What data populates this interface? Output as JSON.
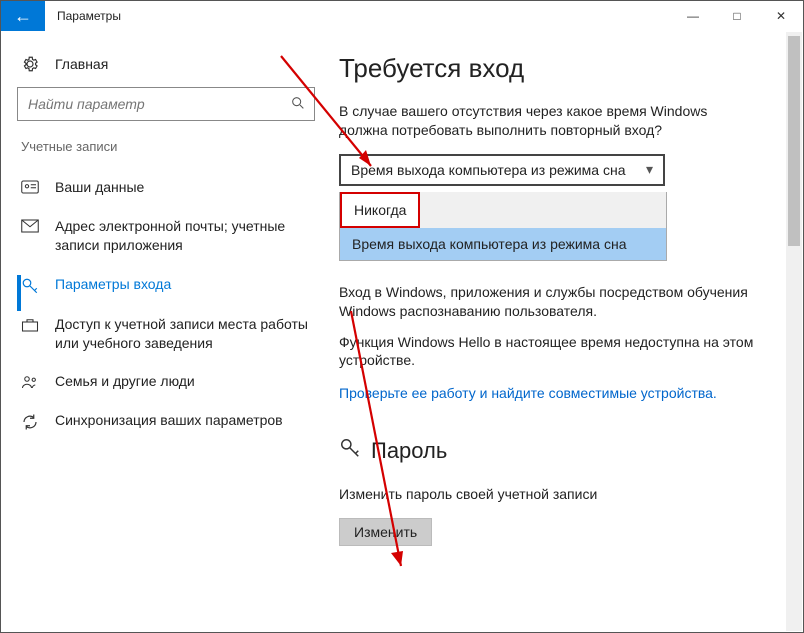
{
  "window": {
    "title": "Параметры"
  },
  "sidebar": {
    "home": "Главная",
    "search_placeholder": "Найти параметр",
    "section": "Учетные записи",
    "items": [
      {
        "label": "Ваши данные"
      },
      {
        "label": "Адрес электронной почты; учетные записи приложения"
      },
      {
        "label": "Параметры входа"
      },
      {
        "label": "Доступ к учетной записи места работы или учебного заведения"
      },
      {
        "label": "Семья и другие люди"
      },
      {
        "label": "Синхронизация ваших параметров"
      }
    ]
  },
  "content": {
    "h1": "Требуется вход",
    "q": "В случае вашего отсутствия через какое время Windows должна потребовать выполнить повторный вход?",
    "combo_value": "Время выхода компьютера из режима сна",
    "options": {
      "never": "Никогда",
      "sleep": "Время выхода компьютера из режима сна"
    },
    "hello1": "Вход в Windows, приложения и службы посредством обучения Windows распознаванию пользователя.",
    "hello2": "Функция Windows Hello в настоящее время недоступна на этом устройстве.",
    "hello_link": "Проверьте ее работу и найдите совместимые устройства.",
    "password_h": "Пароль",
    "password_desc": "Изменить пароль своей учетной записи",
    "change_btn": "Изменить"
  }
}
